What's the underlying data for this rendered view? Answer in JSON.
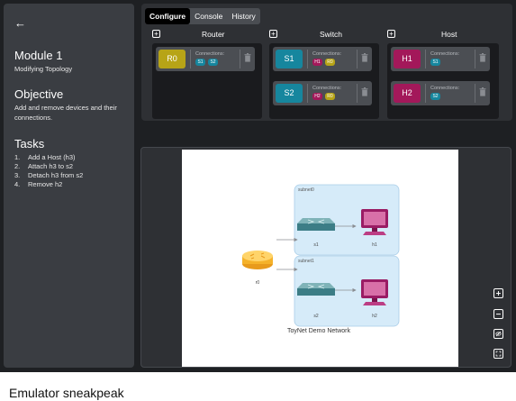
{
  "sidebar": {
    "back_icon": "arrow-left-icon",
    "module_title": "Module 1",
    "module_subtitle": "Modifying Topology",
    "objective_title": "Objective",
    "objective_text": "Add and remove devices and their connections.",
    "tasks_title": "Tasks",
    "tasks": [
      {
        "num": "1.",
        "text": "Add a Host (h3)"
      },
      {
        "num": "2.",
        "text": "Attach h3 to s2"
      },
      {
        "num": "3.",
        "text": "Detach h3 from s2"
      },
      {
        "num": "4.",
        "text": "Remove h2"
      }
    ]
  },
  "tabs": [
    {
      "label": "Configure",
      "active": true
    },
    {
      "label": "Console",
      "active": false
    },
    {
      "label": "History",
      "active": false
    }
  ],
  "columns": {
    "router": {
      "title": "Router",
      "devices": [
        {
          "name": "R0",
          "color": "#b7a417",
          "connections_label": "Connections:",
          "connections": [
            {
              "label": "S1",
              "color": "#16869e"
            },
            {
              "label": "S2",
              "color": "#16869e"
            }
          ]
        }
      ]
    },
    "switch": {
      "title": "Switch",
      "devices": [
        {
          "name": "S1",
          "color": "#16869e",
          "connections_label": "Connections:",
          "connections": [
            {
              "label": "H1",
              "color": "#a3185a"
            },
            {
              "label": "R0",
              "color": "#b7a417"
            }
          ]
        },
        {
          "name": "S2",
          "color": "#16869e",
          "connections_label": "Connections:",
          "connections": [
            {
              "label": "H2",
              "color": "#a3185a"
            },
            {
              "label": "R0",
              "color": "#b7a417"
            }
          ]
        }
      ]
    },
    "host": {
      "title": "Host",
      "devices": [
        {
          "name": "H1",
          "color": "#a3185a",
          "connections_label": "Connections:",
          "connections": [
            {
              "label": "S1",
              "color": "#16869e"
            }
          ]
        },
        {
          "name": "H2",
          "color": "#a3185a",
          "connections_label": "Connections:",
          "connections": [
            {
              "label": "S2",
              "color": "#16869e"
            }
          ]
        }
      ]
    }
  },
  "topology": {
    "subnet0_label": "subnet0",
    "subnet1_label": "subnet1",
    "router_label": "r0",
    "s1_label": "s1",
    "h1_label": "h1",
    "s2_label": "s2",
    "h2_label": "h2",
    "network_title": "ToyNet Demo Network"
  },
  "controls": [
    "zoom-in-icon",
    "zoom-out-icon",
    "hide-icon",
    "fit-screen-icon"
  ],
  "caption": "Emulator sneakpeak"
}
